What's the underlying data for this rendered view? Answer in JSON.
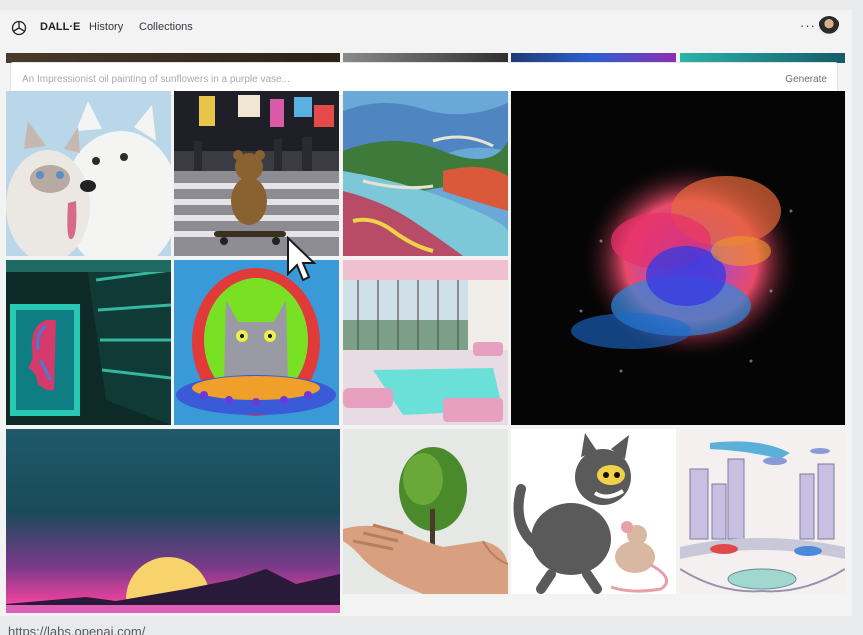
{
  "nav": {
    "brand": "DALL·E",
    "links": [
      "History",
      "Collections"
    ],
    "more": "···"
  },
  "prompt": {
    "placeholder": "An Impressionist oil painting of sunflowers in a purple vase...",
    "generate_label": "Generate"
  },
  "gallery": {
    "tiles": [
      {
        "name": "cat-and-dog-image"
      },
      {
        "name": "teddy-bear-skateboard-image"
      },
      {
        "name": "river-painting-image"
      },
      {
        "name": "color-powder-explosion-image"
      },
      {
        "name": "neon-portrait-corridor-image"
      },
      {
        "name": "cat-ufo-painting-image"
      },
      {
        "name": "pool-room-image"
      },
      {
        "name": "synthwave-sunset-image"
      },
      {
        "name": "tree-in-hand-image"
      },
      {
        "name": "cartoon-cat-mouse-image"
      },
      {
        "name": "futuristic-city-sketch-image"
      }
    ]
  },
  "status_url": "https://labs.openai.com/"
}
